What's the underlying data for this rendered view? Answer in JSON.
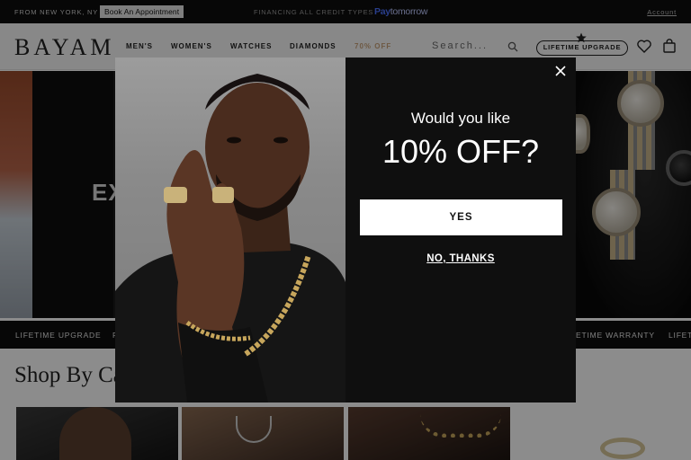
{
  "topbar": {
    "location": "FROM NEW YORK, NY",
    "appointment_label": "Book An Appointment",
    "financing": "FINANCING ALL CREDIT TYPES",
    "paytomorrow_a": "Pay",
    "paytomorrow_b": "tomorrow",
    "account": "Account"
  },
  "header": {
    "logo": "BAYAM",
    "nav": [
      "MEN'S",
      "WOMEN'S",
      "WATCHES",
      "DIAMONDS",
      "70% OFF"
    ],
    "search_placeholder": "Search...",
    "lifetime_upgrade": "LIFETIME UPGRADE"
  },
  "hero": {
    "headline": "EX"
  },
  "ribbon": {
    "items": [
      "LIFETIME UPGRADE",
      "F",
      "ETIME WARRANTY",
      "LIFET"
    ]
  },
  "shop_by": {
    "title": "Shop By Ca"
  },
  "modal": {
    "question_line1": "Would you like",
    "question_line2": "10% OFF?",
    "yes_label": "YES",
    "no_label": "NO, THANKS",
    "close_symbol": "✕"
  },
  "colors": {
    "topbar_bg": "#0d0d0d",
    "accent_sale": "#c8a27a",
    "paytomorrow_blue": "#4b72ff",
    "modal_bg": "#0f0f0f"
  }
}
